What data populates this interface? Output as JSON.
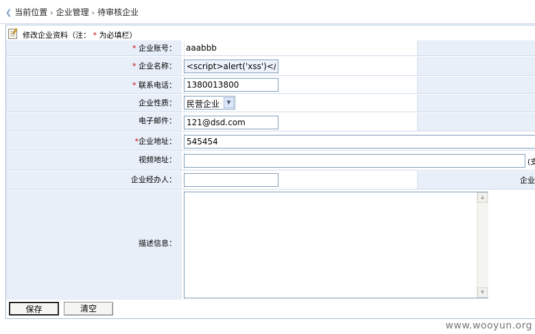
{
  "breadcrumb": {
    "current": "当前位置",
    "level1": "企业管理",
    "level2": "待审核企业"
  },
  "form_caption": {
    "title": "修改企业资料",
    "note_open": "（注：",
    "required_mark": "*",
    "note_text": "为必填栏",
    "note_close": "）"
  },
  "fields": {
    "account": {
      "required": "*",
      "label": "企业账号：",
      "value": "aaabbb"
    },
    "name": {
      "required": "*",
      "label": "企业名称：",
      "value": "<script>alert('xss')</"
    },
    "phone": {
      "required": "*",
      "label": "联系电话：",
      "value": "1380013800"
    },
    "nature": {
      "label": "企业性质：",
      "selected": "民营企业"
    },
    "email": {
      "label": "电子邮件：",
      "value": "121@dsd.com"
    },
    "address": {
      "required": "*",
      "label": "企业地址：",
      "value": "545454"
    },
    "video": {
      "label": "视频地址：",
      "value": "",
      "suffix": "(支"
    },
    "agent": {
      "label": "企业经办人：",
      "value": "",
      "right_label": "企业"
    },
    "description": {
      "label": "描述信息：",
      "value": ""
    }
  },
  "buttons": {
    "save": "保存",
    "clear": "清空"
  },
  "watermark": "www.wooyun.org"
}
